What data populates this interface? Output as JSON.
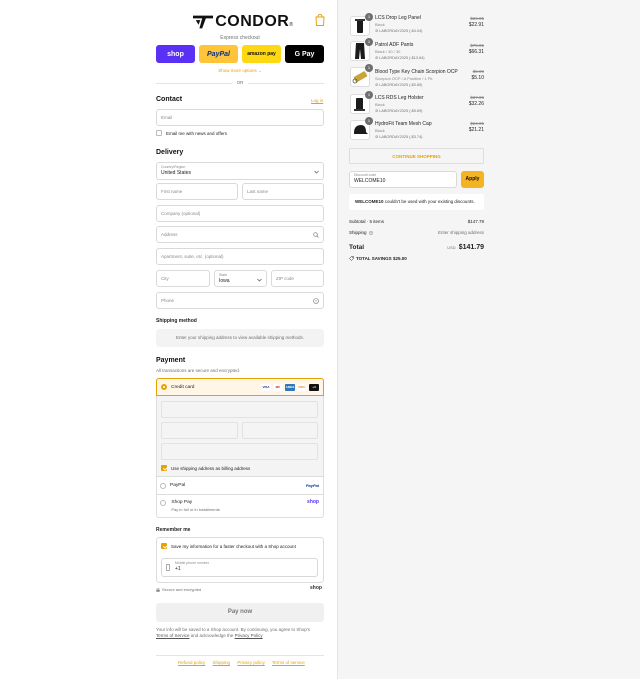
{
  "brand": {
    "name": "CONDOR",
    "registered": "®"
  },
  "express": {
    "label": "Express checkout",
    "buttons": {
      "shop": "shop",
      "paypal": "PayPal",
      "amazon": "amazon pay",
      "gpay": "G Pay"
    },
    "show_more": "Show more options ⌄",
    "or": "OR"
  },
  "contact": {
    "heading": "Contact",
    "login": "Log in",
    "email_placeholder": "Email",
    "newsletter": "Email me with news and offers"
  },
  "delivery": {
    "heading": "Delivery",
    "country_label": "Country/Region",
    "country_value": "United States",
    "first_name": "First name",
    "last_name": "Last name",
    "company": "Company (optional)",
    "address": "Address",
    "apartment": "Apartment, suite, etc. (optional)",
    "city": "City",
    "state_label": "State",
    "state_value": "Iowa",
    "zip": "ZIP code",
    "phone": "Phone"
  },
  "shipping_method": {
    "heading": "Shipping method",
    "notice": "Enter your shipping address to view available shipping methods."
  },
  "payment": {
    "heading": "Payment",
    "subtitle": "All transactions are secure and encrypted.",
    "credit_card": "Credit card",
    "card_brands": [
      "VISA",
      "MC",
      "AMEX",
      "DISC",
      "+4"
    ],
    "billing_same": "Use shipping address as billing address",
    "paypal": "PayPal",
    "paypal_logo": "PayPal",
    "shop_pay": "Shop Pay",
    "shop_pay_sub": "Pay in full or in installments",
    "shop_logo": "shop"
  },
  "remember": {
    "heading": "Remember me",
    "save_info": "Save my information for a faster checkout with a Shop account",
    "phone_label": "Mobile phone number",
    "phone_value": "+1",
    "secure": "Secure and encrypted",
    "shop_logo": "shop"
  },
  "pay_now": "Pay now",
  "legal": {
    "text": "Your info will be saved to a Shop account. By continuing, you agree to Shop's",
    "tos": "Terms of Service",
    "and": "and acknowledge the",
    "privacy": "Privacy Policy"
  },
  "footer_links": [
    "Refund policy",
    "Shipping",
    "Privacy policy",
    "Terms of service"
  ],
  "cart": {
    "items": [
      {
        "qty": "1",
        "name": "LCS Drop Leg Panel",
        "variant": "Black",
        "code": "LABORDAY2025 (-$4.04)",
        "old": "$26.95",
        "new": "$22.91"
      },
      {
        "qty": "1",
        "name": "Patrol ADF Pants",
        "variant": "Black / 30 / 30",
        "code": "LABORDAY2025 (-$13.64)",
        "old": "$79.95",
        "new": "$66.31"
      },
      {
        "qty": "1",
        "name": "Blood Type Key Chain Scorpion OCP",
        "variant": "Scorpion OCP / A Positive / 1 Pk",
        "code": "LABORDAY2025 (-$0.89)",
        "old": "$5.99",
        "new": "$5.10"
      },
      {
        "qty": "1",
        "name": "LCS RDS Leg Holster",
        "variant": "Black",
        "code": "LABORDAY2025 (-$5.69)",
        "old": "$37.95",
        "new": "$32.26"
      },
      {
        "qty": "1",
        "name": "HydroFit Team Mesh Cap",
        "variant": "Black",
        "code": "LABORDAY2025 (-$3.74)",
        "old": "$24.95",
        "new": "$21.21"
      }
    ],
    "continue": "CONTINUE SHOPPING",
    "discount_label": "Discount code",
    "discount_value": "WELCOME10",
    "apply": "Apply",
    "discount_error_code": "WELCOME10",
    "discount_error_text": "couldn't be used with your existing discounts.",
    "subtotal_label": "Subtotal · 5 items",
    "subtotal_value": "$147.79",
    "shipping_label": "Shipping",
    "shipping_value": "Enter shipping address",
    "total_label": "Total",
    "currency": "USD",
    "total_value": "$141.79",
    "savings_label": "TOTAL SAVINGS",
    "savings_value": "$25.00"
  },
  "colors": {
    "accent": "#e8a100",
    "shop": "#5a31f4",
    "paypal": "#ffc439",
    "amazon": "#ffd814"
  }
}
